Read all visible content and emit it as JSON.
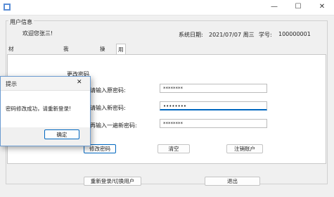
{
  "window": {
    "title": "",
    "minimize": "—",
    "maximize": "☐",
    "close": "✕"
  },
  "user_info": {
    "group_label": "用户信息",
    "welcome": "欢迎您张三!",
    "date_label": "系统日期:",
    "date_value": "2021/07/07 周三",
    "id_label": "学号:",
    "id_value": "100000001"
  },
  "tabs": [
    {
      "label": "材料剩余量信息查询",
      "active": false
    },
    {
      "label": "我的借用查询",
      "active": false
    },
    {
      "label": "操作",
      "active": false
    },
    {
      "label": "用户信息设置",
      "active": true
    }
  ],
  "settings": {
    "section_title": "更改密码",
    "old_pwd_label": "请输入原密码:",
    "old_pwd_value": "********",
    "new_pwd_label": "请输入新密码:",
    "new_pwd_value": "••••••••",
    "confirm_pwd_label": "再输入一遍新密码:",
    "confirm_pwd_value": "********",
    "change_button": "修改密码",
    "clear_button": "清空",
    "cancel_account_button": "注销账户"
  },
  "footer": {
    "relogin_button": "重新登录/切换用户",
    "exit_button": "退出"
  },
  "dialog": {
    "title": "提示",
    "close": "✕",
    "message": "密码修改成功，请重新登录!",
    "ok_button": "确定"
  },
  "colors": {
    "accent": "#0067c0",
    "dialog_border": "#6b9bd1"
  }
}
